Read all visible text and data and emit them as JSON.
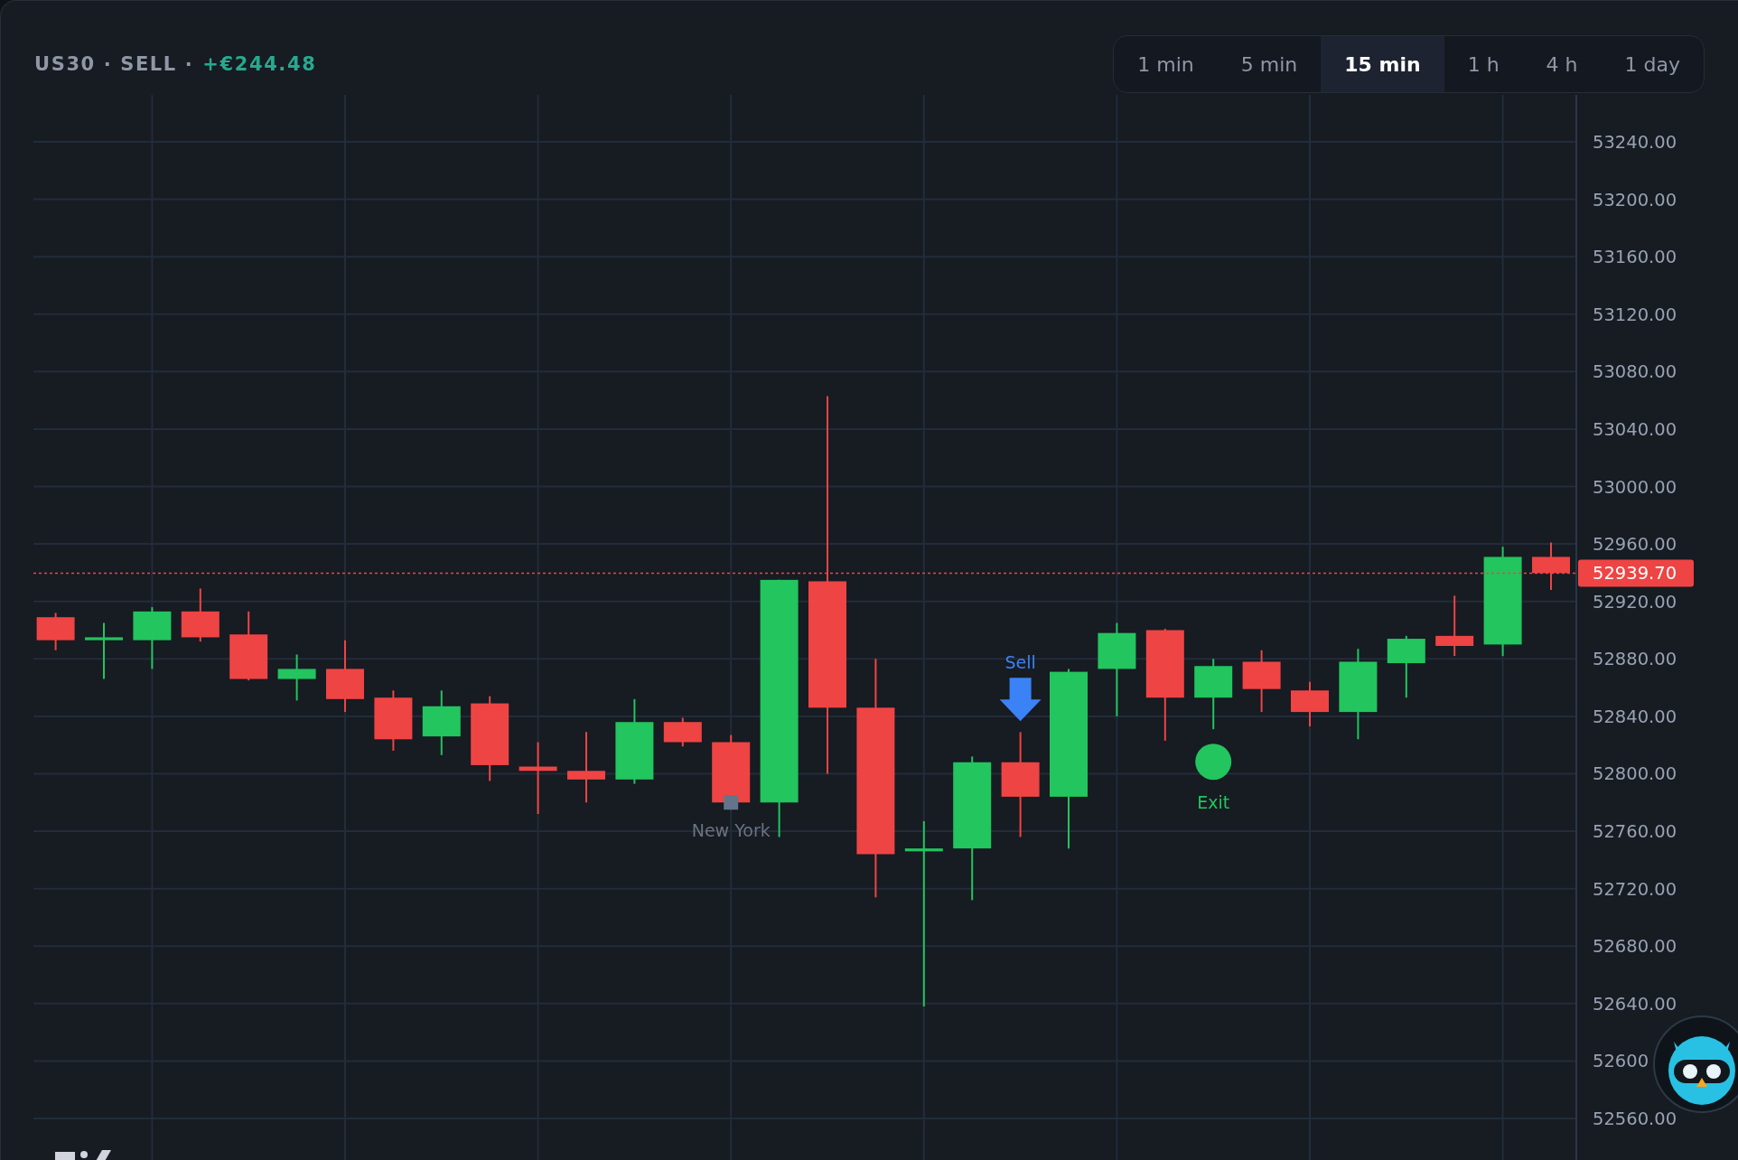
{
  "header": {
    "title": "US30 · SELL ·",
    "pnl": "+€244.48"
  },
  "timeframes": [
    {
      "label": "1 min",
      "selected": false
    },
    {
      "label": "5 min",
      "selected": false
    },
    {
      "label": "15 min",
      "selected": true
    },
    {
      "label": "1 h",
      "selected": false
    },
    {
      "label": "4 h",
      "selected": false
    },
    {
      "label": "1 day",
      "selected": false
    }
  ],
  "chart": {
    "price_axis": [
      "53240.00",
      "53200.00",
      "53160.00",
      "53120.00",
      "53080.00",
      "53040.00",
      "53000.00",
      "52960.00",
      "52920.00",
      "52880.00",
      "52840.00",
      "52800.00",
      "52760.00",
      "52720.00",
      "52680.00",
      "52640.00",
      "52600",
      "52560.00"
    ],
    "current_price": "52939.70",
    "markers": [
      {
        "kind": "session",
        "label": "New York"
      },
      {
        "kind": "sell",
        "label": "Sell"
      },
      {
        "kind": "exit",
        "label": "Exit"
      }
    ]
  }
}
